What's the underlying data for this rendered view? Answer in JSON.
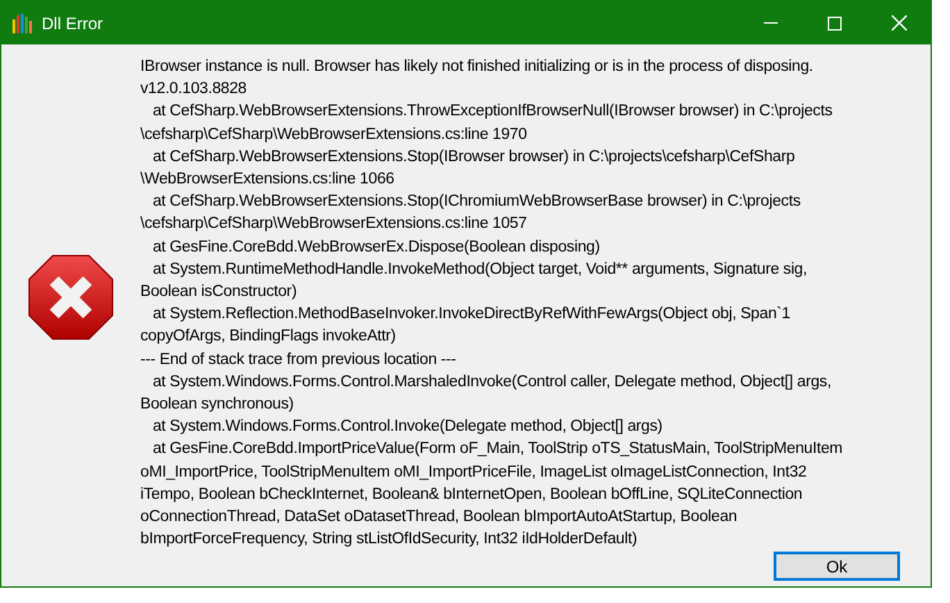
{
  "window": {
    "title": "Dll Error"
  },
  "message_lines": [
    "IBrowser instance is null. Browser has likely not finished initializing or is in the process of disposing.",
    "v12.0.103.8828",
    "   at CefSharp.WebBrowserExtensions.ThrowExceptionIfBrowserNull(IBrowser browser) in C:\\projects",
    "\\cefsharp\\CefSharp\\WebBrowserExtensions.cs:line 1970",
    "   at CefSharp.WebBrowserExtensions.Stop(IBrowser browser) in C:\\projects\\cefsharp\\CefSharp",
    "\\WebBrowserExtensions.cs:line 1066",
    "   at CefSharp.WebBrowserExtensions.Stop(IChromiumWebBrowserBase browser) in C:\\projects",
    "\\cefsharp\\CefSharp\\WebBrowserExtensions.cs:line 1057",
    "   at GesFine.CoreBdd.WebBrowserEx.Dispose(Boolean disposing)",
    "   at System.RuntimeMethodHandle.InvokeMethod(Object target, Void** arguments, Signature sig,",
    "Boolean isConstructor)",
    "   at System.Reflection.MethodBaseInvoker.InvokeDirectByRefWithFewArgs(Object obj, Span`1",
    "copyOfArgs, BindingFlags invokeAttr)",
    "--- End of stack trace from previous location ---",
    "   at System.Windows.Forms.Control.MarshaledInvoke(Control caller, Delegate method, Object[] args,",
    "Boolean synchronous)",
    "   at System.Windows.Forms.Control.Invoke(Delegate method, Object[] args)",
    "   at GesFine.CoreBdd.ImportPriceValue(Form oF_Main, ToolStrip oTS_StatusMain, ToolStripMenuItem",
    "oMI_ImportPrice, ToolStripMenuItem oMI_ImportPriceFile, ImageList oImageListConnection, Int32",
    "iTempo, Boolean bCheckInternet, Boolean& bInternetOpen, Boolean bOffLine, SQLiteConnection",
    "oConnectionThread, DataSet oDatasetThread, Boolean bImportAutoAtStartup, Boolean",
    "bImportForceFrequency, String stListOfIdSecurity, Int32 iIdHolderDefault)"
  ],
  "buttons": [
    {
      "label": "Ok",
      "selected": true
    }
  ]
}
